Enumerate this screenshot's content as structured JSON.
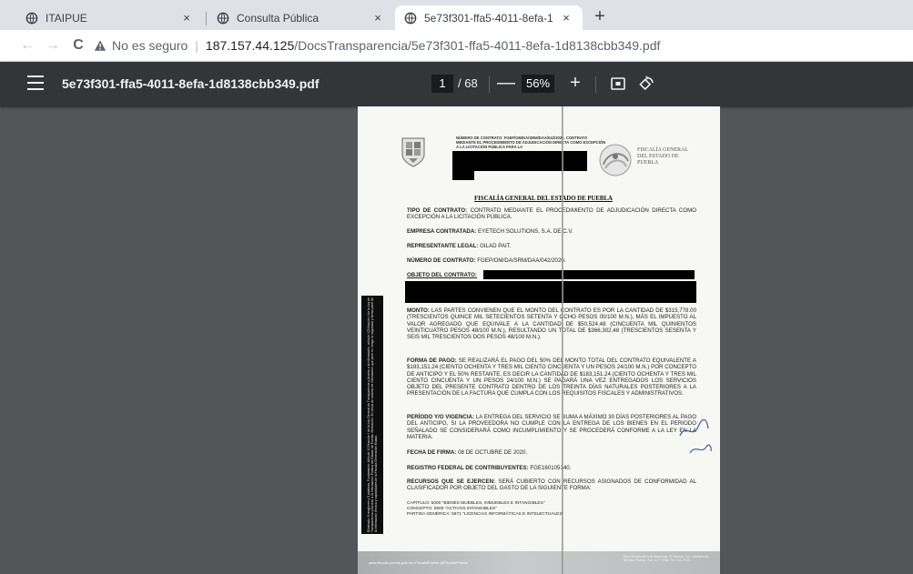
{
  "tabs": [
    {
      "title": "ITAIPUE",
      "close": "×",
      "active": false
    },
    {
      "title": "Consulta Pública",
      "close": "×",
      "active": false
    },
    {
      "title": "5e73f301-ffa5-4011-8efa-1d8138cbb349.pdf",
      "close": "×",
      "active": true
    }
  ],
  "new_tab": "+",
  "nav": {
    "back": "←",
    "forward": "→",
    "reload": "C"
  },
  "address": {
    "security_label": "No es seguro",
    "separator": "|",
    "host": "187.157.44.125",
    "path": "/DocsTransparencia/5e73f301-ffa5-4011-8efa-1d8138cbb349.pdf"
  },
  "pdf_toolbar": {
    "title": "5e73f301-ffa5-4011-8efa-1d8138cbb349.pdf",
    "current_page": "1",
    "total_pages": "/ 68",
    "zoom_out": "—",
    "zoom": "56%",
    "zoom_in": "+"
  },
  "document": {
    "header_small": "NÚMERO DE CONTRATO: FGEP/OM/DA/SRM/DAA/042/2020. CONTRATO MEDIANTE EL PROCEDIMIENTO DE ADJUDICACIÓN DIRECTA COMO EXCEPCIÓN A LA LICITACIÓN PÚBLICA PARA LA",
    "org_logo_text": "FISCALÍA GENERAL DEL ESTADO DE PUEBLA",
    "heading": "FISCALÍA GENERAL DEL ESTADO DE PUEBLA",
    "tipo_label": "TIPO DE CONTRATO:",
    "tipo_text": "CONTRATO MEDIANTE EL PROCEDIMIENTO DE ADJUDICACIÓN DIRECTA COMO EXCEPCIÓN A LA LICITACIÓN PÚBLICA.",
    "empresa_label": "EMPRESA CONTRATADA:",
    "empresa_text": "EYETECH SOLUTIONS, S.A. DE C.V.",
    "rep_label": "REPRESENTANTE LEGAL:",
    "rep_text": "GILAD PAIT.",
    "numero_label": "NÚMERO DE CONTRATO:",
    "numero_text": "FGEP/OM/DA/SRM/DAA/042/2020.",
    "objeto_label": "OBJETO DEL CONTRATO:",
    "monto_label": "MONTO:",
    "monto_text": "LAS PARTES CONVIENEN QUE EL MONTO DEL CONTRATO ES POR LA CANTIDAD DE $315,778.00 (TRESCIENTOS QUINCE MIL SETECIENTOS SETENTA Y OCHO PESOS 00/100 M.N.), MÁS EL IMPUESTO AL VALOR AGREGADO QUE EQUIVALE A LA CANTIDAD DE $50,524.48 (CINCUENTA MIL QUINIENTOS VEINTICUATRO PESOS 48/100 M.N.), RESULTANDO UN TOTAL DE $366,302.48 (TRESCIENTOS SESENTA Y SEIS MIL TRESCIENTOS DOS PESOS 48/100 M.N.).",
    "forma_label": "FORMA DE PAGO:",
    "forma_text": "SE REALIZARÁ EL PAGO DEL 50% DEL MONTO TOTAL DEL CONTRATO EQUIVALENTE A $183,151.24 (CIENTO OCHENTA Y TRES MIL CIENTO CINCUENTA Y UN PESOS 24/100 M.N.) POR CONCEPTO DE ANTICIPO Y EL 50% RESTANTE, ES DECIR LA CANTIDAD DE $183,151.24 (CIENTO OCHENTA Y TRES MIL CIENTO CINCUENTA Y UN PESOS 24/100 M.N.) SE PAGARÁ UNA VEZ ENTREGADOS LOS SERVICIOS OBJETO DEL PRESENTE CONTRATO DENTRO DE LOS TREINTA DÍAS NATURALES POSTERIORES A LA PRESENTACIÓN DE LA FACTURA QUE CUMPLA CON LOS REQUISITOS FISCALES Y ADMINISTRATIVOS.",
    "periodo_label": "PERÍODO Y/O VIGENCIA:",
    "periodo_text": "LA ENTREGA DEL SERVICIO SE SUMA A MÁXIMO 30 DÍAS POSTERIORES AL PAGO DEL ANTICIPO, SI LA PROVEEDORA NO CUMPLE CON LA ENTREGA DE LOS BIENES EN EL PERIODO SEÑALADO SE CONSIDERARÁ COMO INCUMPLIMIENTO Y SE PROCEDERÁ CONFORME A LA LEY EN LA MATERIA.",
    "fecha_label": "FECHA DE FIRMA:",
    "fecha_text": "08 DE OCTUBRE DE 2020.",
    "rfc_label": "REGISTRO FEDERAL DE CONTRIBUYENTES:",
    "rfc_text": "FGE160105140.",
    "recursos_label": "RECURSOS QUE SE EJERCEN:",
    "recursos_text": "SERÁ CUBIERTO CON RECURSOS ASIGNADOS DE CONFORMIDAD AL CLASIFICADOR POR OBJETO DEL GASTO DE LA SIGUIENTE FORMA:",
    "capitulo": "CAPÍTULO: 5000 \"BIENES MUEBLES, INMUEBLES E INTANGIBLES\"",
    "concepto": "CONCEPTO: 5900 \"ACTIVOS INTANGIBLES\"",
    "partida": "PARTIDA GENÉRICA: 5971 \"LICENCIAS INFORMÁTICAS E INTELECTUALES\"",
    "side_note": "Eliminado: 8 renglones y 5 palabras. Fundamento: Artículo 113 fracción I de la Ley General de Transparencia y Acceso a la Información, artículo 123 fracción I de la Ley de Transparencia y Acceso a la Información Pública del Estado de Puebla. Motivación: En virtud de tratarse de información que pone en riesgo la seguridad y forma parte de la información técnica y capacidades de la Fiscalía General del Estado.",
    "footer_left": "www.fiscalia.puebla.gob.mx   /FiscaliaPuebla   @FiscaliaPuebla",
    "footer_right": "Blvd. Héroes del 5 de Mayo esq. 31 Oriente, Col. Ladrillera de Benítez, Puebla, Pue. C.P. 72530 Tel. 2 11 79 00"
  },
  "colors": {
    "viewer_bg": "#525659",
    "pdf_toolbar": "#323639",
    "tabstrip": "#dee1e6"
  }
}
